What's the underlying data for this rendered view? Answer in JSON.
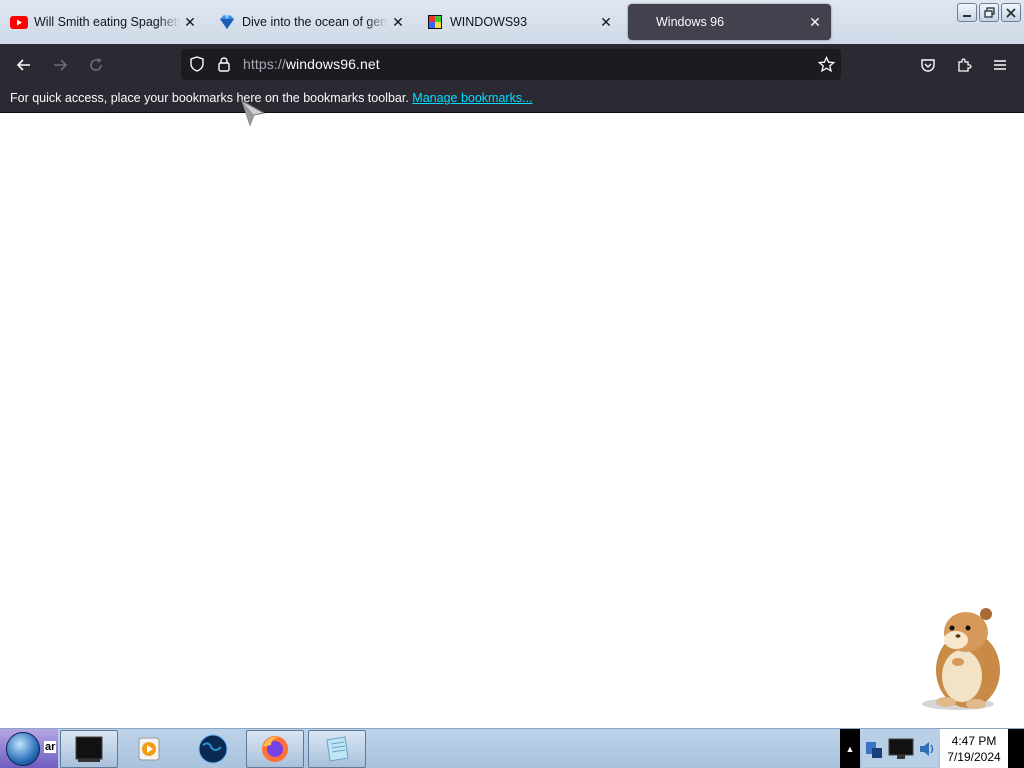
{
  "tabs": [
    {
      "title": "Will Smith eating Spaghetti a",
      "favicon": "youtube-icon",
      "active": false
    },
    {
      "title": "Dive into the ocean of genui",
      "favicon": "blue-gem-icon",
      "active": false
    },
    {
      "title": "WINDOWS93",
      "favicon": "windows93-icon",
      "active": false
    },
    {
      "title": "Windows 96",
      "favicon": "",
      "active": true
    }
  ],
  "navbar": {
    "url_scheme": "https://",
    "url_host": "windows96.net"
  },
  "bookmarks_bar": {
    "message": "For quick access, place your bookmarks here on the bookmarks toolbar.",
    "link": "Manage bookmarks..."
  },
  "taskbar": {
    "start_label": "ar",
    "items": [
      "terminal-icon",
      "media-player-icon",
      "globe-icon",
      "firefox-icon",
      "notepad-icon"
    ],
    "clock_time": "4:47 PM",
    "clock_date": "7/19/2024"
  },
  "colors": {
    "toolbar": "#2b2a33",
    "urlbar": "#1c1b22",
    "active_tab": "#42414d",
    "link": "#00ddff"
  }
}
